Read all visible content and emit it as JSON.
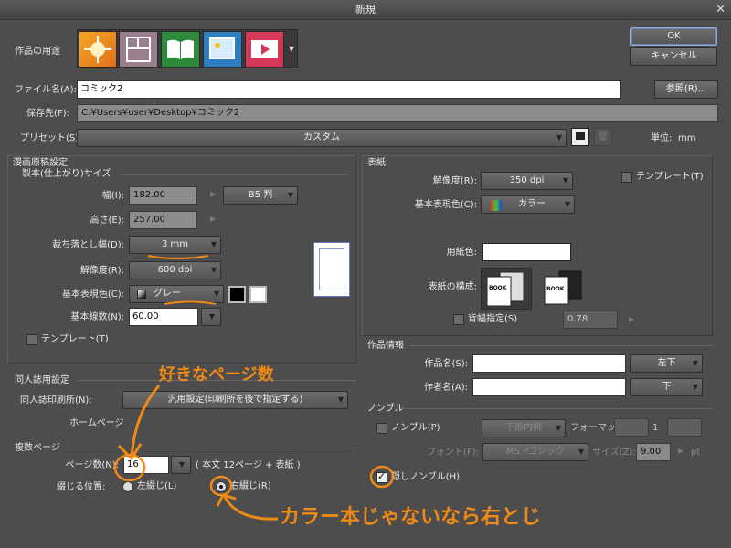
{
  "window": {
    "title": "新規",
    "close_glyph": "✕"
  },
  "purpose": {
    "label": "作品の用途"
  },
  "buttons": {
    "ok": "OK",
    "cancel": "キャンセル",
    "browse": "参照(R)..."
  },
  "file": {
    "name_label": "ファイル名(A):",
    "name_value": "コミック2",
    "path_label": "保存先(F):",
    "path_value": "C:¥Users¥user¥Desktop¥コミック2"
  },
  "preset": {
    "label": "プリセット(S):",
    "value": "カスタム",
    "unit_label": "単位:",
    "unit_value": "mm"
  },
  "manga": {
    "section": "漫画原稿設定",
    "size_group": "製本(仕上がり)サイズ",
    "width_label": "幅(I):",
    "width_value": "182.00",
    "height_label": "高さ(E):",
    "height_value": "257.00",
    "paper_size": "B5 判",
    "bleed_label": "裁ち落とし幅(D):",
    "bleed_value": "3 mm",
    "res_label": "解像度(R):",
    "res_value": "600 dpi",
    "color_label": "基本表現色(C):",
    "color_value": "グレー",
    "lines_label": "基本線数(N):",
    "lines_value": "60.00",
    "template_label": "テンプレート(T)"
  },
  "doujin": {
    "section": "同人誌用設定",
    "printer_label": "同人誌印刷所(N):",
    "printer_value": "汎用設定(印刷所を後で指定する)",
    "homepage": "ホームページ"
  },
  "multi": {
    "section": "複数ページ",
    "pages_label": "ページ数(N):",
    "pages_value": "16",
    "pages_note": "( 本文 12ページ + 表紙 )",
    "binding_label": "綴じる位置:",
    "left_label": "左綴じ(L)",
    "right_label": "右綴じ(R)"
  },
  "cover": {
    "section": "表紙",
    "res_label": "解像度(R):",
    "res_value": "350 dpi",
    "template_label": "テンプレート(T)",
    "color_label": "基本表現色(C):",
    "color_value": "カラー",
    "paper_color_label": "用紙色:",
    "config_label": "表紙の構成:",
    "book_label": "BOOK",
    "spine_label": "背幅指定(S)",
    "spine_value": "0.78"
  },
  "work_info": {
    "section": "作品情報",
    "title_label": "作品名(S):",
    "title_pos": "左下",
    "author_label": "作者名(A):",
    "author_pos": "下"
  },
  "nombre": {
    "section": "ノンブル",
    "enable_label": "ノンブル(P)",
    "pos_value": "下部内側",
    "format_label": "フォーマット:",
    "format_value": "1",
    "font_label": "フォント(F):",
    "font_value": "MS Pゴシック",
    "size_label": "サイズ(Z):",
    "size_value": "9.00",
    "size_unit": "pt",
    "hidden_label": "隠しノンブル(H)"
  },
  "annotations": {
    "note1": "好きなページ数",
    "note2": "カラー本じゃないなら右とじ"
  },
  "colors": {
    "accent_orange": "#f08a16",
    "bg": "#4d4d4d"
  }
}
